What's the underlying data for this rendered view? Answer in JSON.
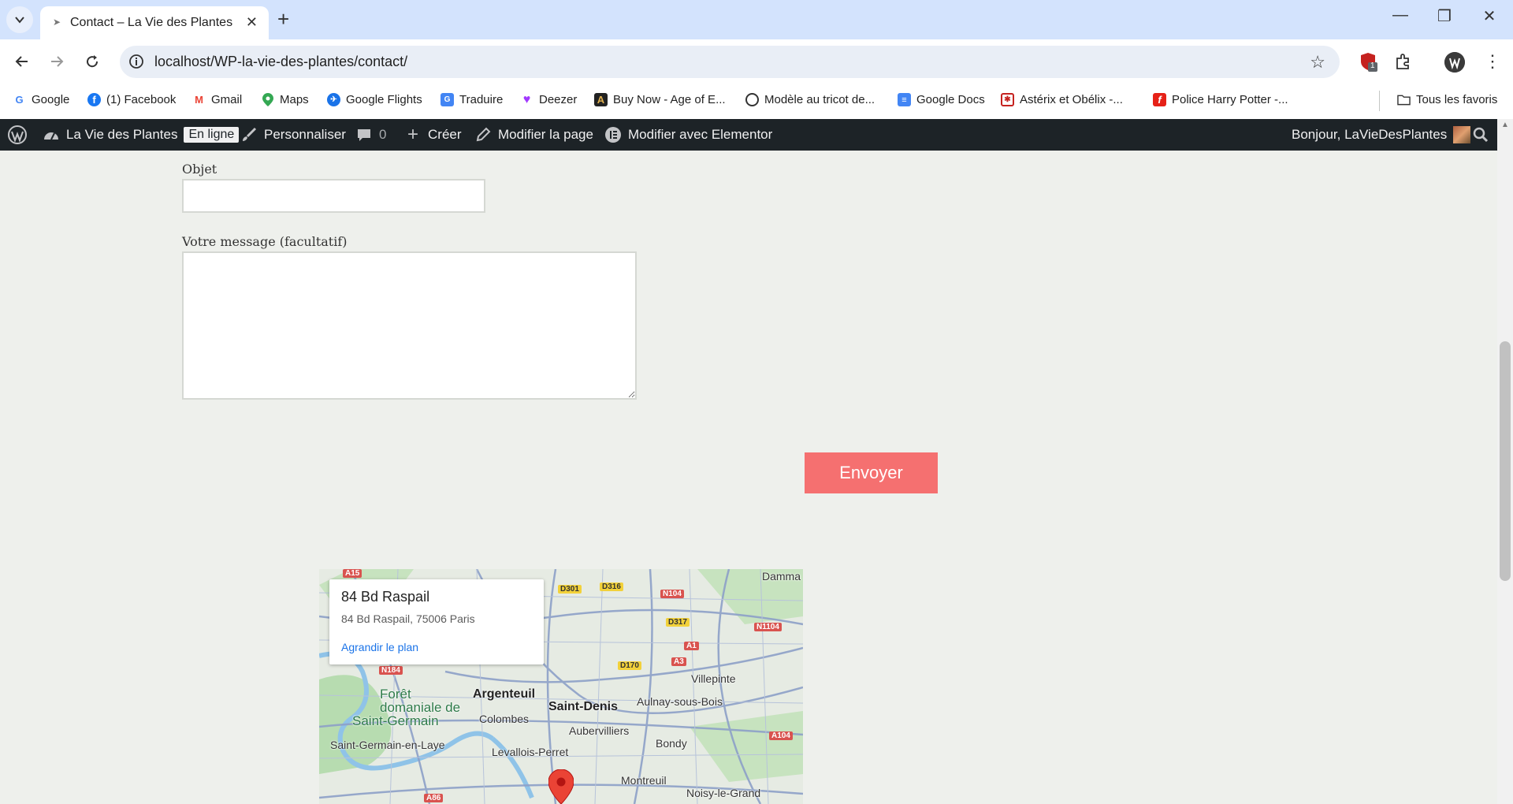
{
  "browser": {
    "tab_title": "Contact – La Vie des Plantes",
    "url": "localhost/WP-la-vie-des-plantes/contact/",
    "extension_badge": "1",
    "bookmarks": [
      {
        "label": "Google",
        "icon": "google-icon"
      },
      {
        "label": "(1) Facebook",
        "icon": "facebook-icon"
      },
      {
        "label": "Gmail",
        "icon": "gmail-icon"
      },
      {
        "label": "Maps",
        "icon": "maps-icon"
      },
      {
        "label": "Google Flights",
        "icon": "flights-icon"
      },
      {
        "label": "Traduire",
        "icon": "translate-icon"
      },
      {
        "label": "Deezer",
        "icon": "deezer-icon"
      },
      {
        "label": "Buy Now - Age of E...",
        "icon": "age-icon"
      },
      {
        "label": "Modèle au tricot de...",
        "icon": "knit-icon"
      },
      {
        "label": "Google Docs",
        "icon": "docs-icon"
      },
      {
        "label": "Astérix et Obélix -...",
        "icon": "asterix-icon"
      },
      {
        "label": "Police Harry Potter -...",
        "icon": "font-icon"
      }
    ],
    "all_bookmarks": "Tous les favoris"
  },
  "adminbar": {
    "site_name": "La Vie des Plantes",
    "status_badge": "En ligne",
    "customize": "Personnaliser",
    "comments_count": "0",
    "create": "Créer",
    "edit_page": "Modifier la page",
    "edit_elementor": "Modifier avec Elementor",
    "greeting": "Bonjour, LaVieDesPlantes"
  },
  "form": {
    "subject_label": "Objet",
    "subject_value": "",
    "message_label": "Votre message (facultatif)",
    "message_value": "",
    "submit_label": "Envoyer"
  },
  "map": {
    "card_title": "84 Bd Raspail",
    "card_address": "84 Bd Raspail, 75006 Paris",
    "card_link": "Agrandir le plan",
    "places": {
      "argenteuil": "Argenteuil",
      "saint_denis": "Saint-Denis",
      "colombes": "Colombes",
      "aubervilliers": "Aubervilliers",
      "aulnay": "Aulnay-sous-Bois",
      "villepinte": "Villepinte",
      "bondy": "Bondy",
      "levallois": "Levallois-Perret",
      "saint_germain_laye": "Saint-Germain-en-Laye",
      "montreuil": "Montreuil",
      "noisy": "Noisy-le-Grand",
      "damma": "Damma",
      "foret1": "Forêt",
      "foret2": "domaniale de",
      "foret3": "Saint-Germain"
    },
    "roads": {
      "a15": "A15",
      "d301": "D301",
      "d316": "D316",
      "n104": "N104",
      "n1104": "N1104",
      "d317": "D317",
      "a1": "A1",
      "a3": "A3",
      "d170": "D170",
      "n184": "N184",
      "a104": "A104",
      "a86": "A86"
    }
  },
  "colors": {
    "accent_button": "#f57070",
    "admin_bar": "#1d2327",
    "page_bg": "#eef0ec",
    "link": "#1a73e8"
  }
}
